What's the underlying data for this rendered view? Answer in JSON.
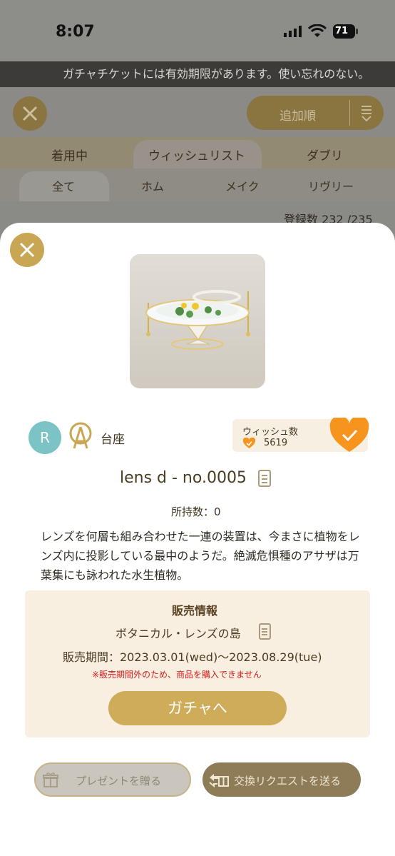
{
  "status_bar": {
    "time": "8:07",
    "battery": "71"
  },
  "marquee": {
    "text": "ガチャチケットには有効期限があります。使い忘れのない。"
  },
  "header": {
    "sort_label": "追加順"
  },
  "tabs": [
    {
      "label": "着用中"
    },
    {
      "label": "ウィッシュリスト"
    },
    {
      "label": "ダブリ"
    }
  ],
  "subtabs": [
    {
      "label": "全て"
    },
    {
      "label": "ホム"
    },
    {
      "label": "メイク"
    },
    {
      "label": "リヴリー"
    }
  ],
  "count": {
    "text": "登録数 232 /235"
  },
  "item": {
    "owner_initial": "R",
    "category": "台座",
    "wish_label": "ウィッシュ数",
    "wish_count": "5619",
    "name": "lens d - no.0005",
    "owned": "所持数：0",
    "description": "レンズを何層も組み合わせた一連の装置は、今まさに植物をレンズ内に投影している最中のようだ。絶滅危惧種のアサザは万葉集にも詠われた水生植物。"
  },
  "sale": {
    "title": "販売情報",
    "event": "ボタニカル・レンズの島",
    "period": "販売期間：2023.03.01(wed)〜2023.08.29(tue)",
    "warning": "※販売期間外のため、商品を購入できません",
    "gacha_button": "ガチャへ"
  },
  "actions": {
    "present": "プレゼントを贈る",
    "trade": "交換リクエストを送る"
  },
  "colors": {
    "accent_gold": "#cfac5a",
    "wish_orange": "#f7941d",
    "warning_red": "#d52020",
    "avatar_teal": "#7cc3c6"
  }
}
